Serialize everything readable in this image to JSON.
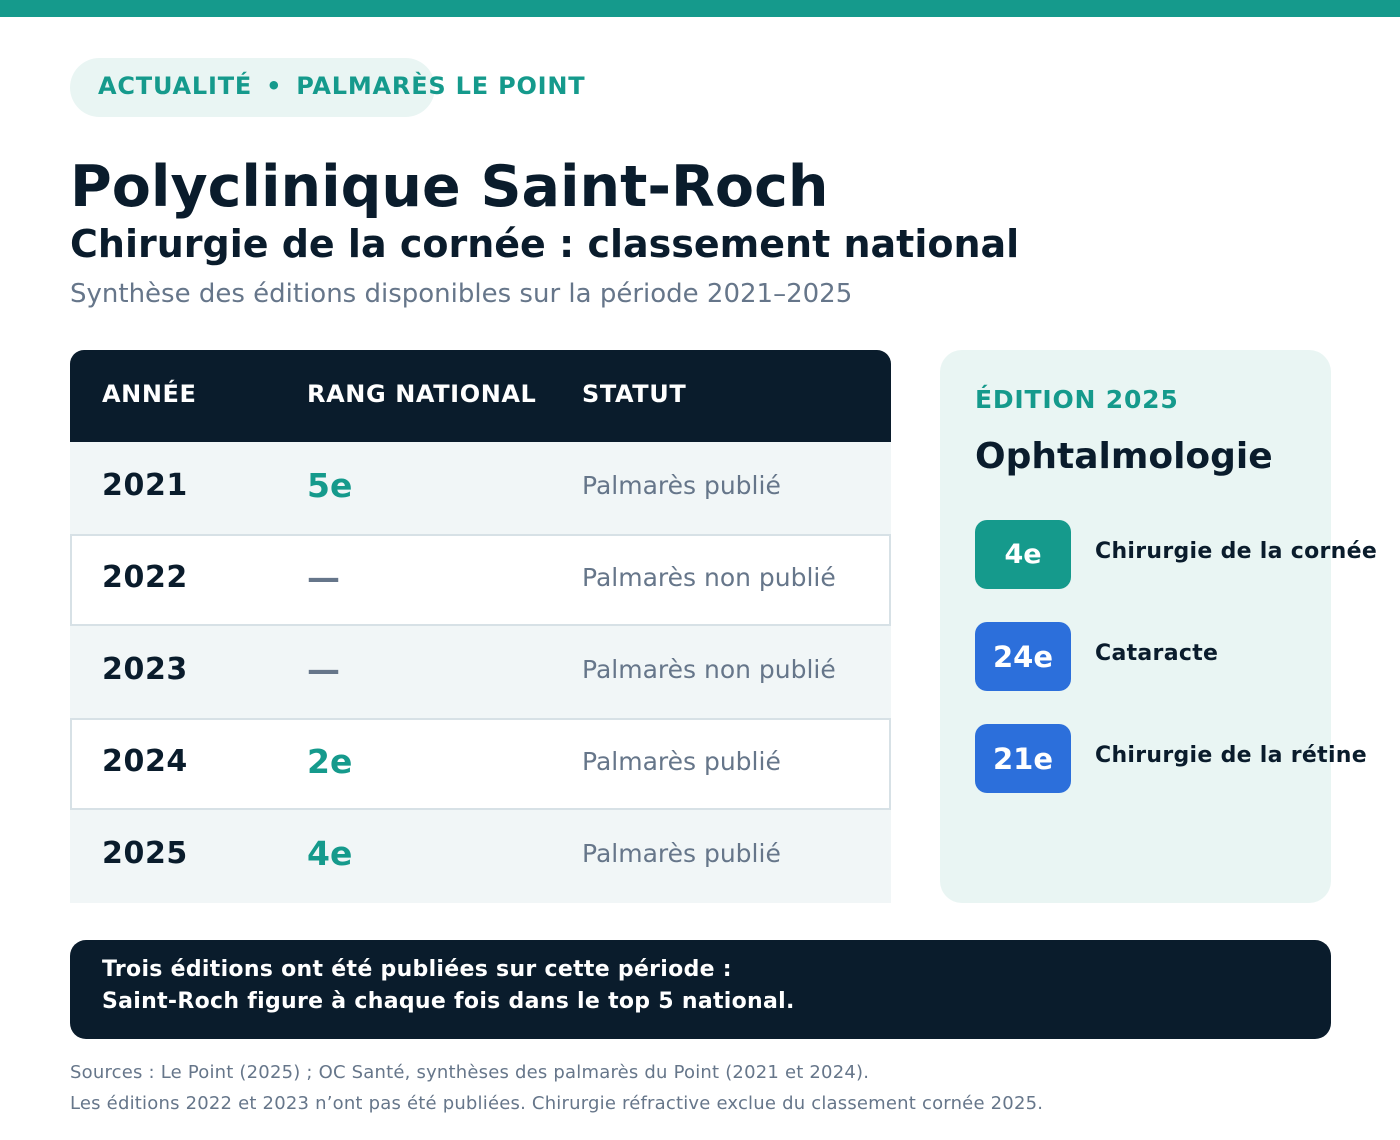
{
  "header": {
    "tag_left": "ACTUALITÉ",
    "tag_separator": "•",
    "tag_right": "PALMARÈS LE POINT",
    "title": "Polyclinique Saint-Roch",
    "subtitle": "Chirurgie de la cornée : classement national",
    "description": "Synthèse des éditions disponibles sur la période 2021–2025"
  },
  "table": {
    "columns": [
      "ANNÉE",
      "RANG NATIONAL",
      "STATUT"
    ],
    "rows": [
      {
        "year": "2021",
        "rank": "5e",
        "status": "Palmarès publié"
      },
      {
        "year": "2022",
        "rank": "—",
        "status": "Palmarès non publié"
      },
      {
        "year": "2023",
        "rank": "—",
        "status": "Palmarès non publié"
      },
      {
        "year": "2024",
        "rank": "2e",
        "status": "Palmarès publié"
      },
      {
        "year": "2025",
        "rank": "4e",
        "status": "Palmarès publié"
      }
    ]
  },
  "card": {
    "eyebrow": "ÉDITION 2025",
    "title": "Ophtalmologie",
    "items": [
      {
        "rank": "4e",
        "label": "Chirurgie de la cornée",
        "color": "#159a8c"
      },
      {
        "rank": "24e",
        "label": "Cataracte",
        "color": "#2c6fdb"
      },
      {
        "rank": "21e",
        "label": "Chirurgie de la rétine",
        "color": "#2c6fdb"
      }
    ]
  },
  "banner": {
    "line1": "Trois éditions ont été publiées sur cette période :",
    "line2": "Saint-Roch figure à chaque fois dans le top 5 national."
  },
  "sources": {
    "line1": "Sources : Le Point (2025) ; OC Santé, synthèses des palmarès du Point (2021 et 2024).",
    "line2": "Les éditions 2022 et 2023 n’ont pas été publiées. Chirurgie réfractive exclue du classement cornée 2025."
  },
  "colors": {
    "accent": "#159a8c",
    "navy": "#0a1c2c",
    "blue": "#2c6fdb",
    "muted": "#66768a"
  }
}
